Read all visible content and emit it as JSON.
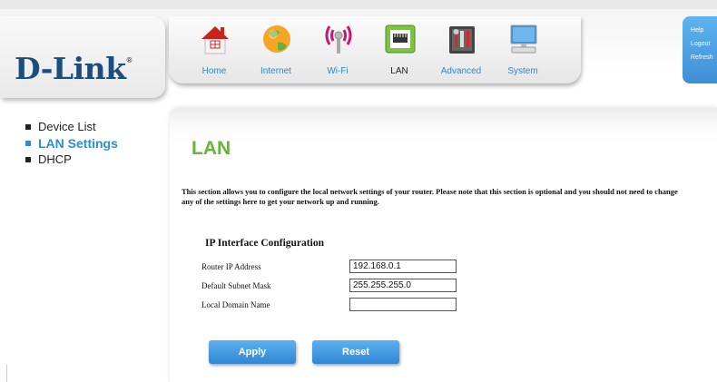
{
  "brand": {
    "name": "D-Link",
    "reg": "®"
  },
  "nav": [
    {
      "id": "home",
      "label": "Home",
      "icon": "home-icon"
    },
    {
      "id": "internet",
      "label": "Internet",
      "icon": "globe-icon"
    },
    {
      "id": "wifi",
      "label": "Wi-Fi",
      "icon": "wifi-icon"
    },
    {
      "id": "lan",
      "label": "LAN",
      "icon": "lan-icon",
      "active": true
    },
    {
      "id": "advanced",
      "label": "Advanced",
      "icon": "tools-icon"
    },
    {
      "id": "system",
      "label": "System",
      "icon": "computer-icon"
    }
  ],
  "side_buttons": [
    "Help",
    "Logout",
    "Refresh"
  ],
  "leftnav": [
    {
      "label": "Device List",
      "selected": false
    },
    {
      "label": "LAN Settings",
      "selected": true
    },
    {
      "label": "DHCP",
      "selected": false
    }
  ],
  "page": {
    "title": "LAN",
    "description": "This section allows you to configure the local network settings of your router. Please note that this section is optional and you should not need to change any of the settings here to get your network up and running.",
    "section_title": "IP Interface Configuration",
    "fields": [
      {
        "label": "Router IP Address",
        "value": "192.168.0.1"
      },
      {
        "label": "Default Subnet Mask",
        "value": "255.255.255.0"
      },
      {
        "label": "Local Domain Name",
        "value": ""
      }
    ],
    "apply_label": "Apply",
    "reset_label": "Reset"
  },
  "colors": {
    "accent_blue": "#2f86c9",
    "title_green": "#6ab23e",
    "brand_navy": "#1d4d7c"
  }
}
